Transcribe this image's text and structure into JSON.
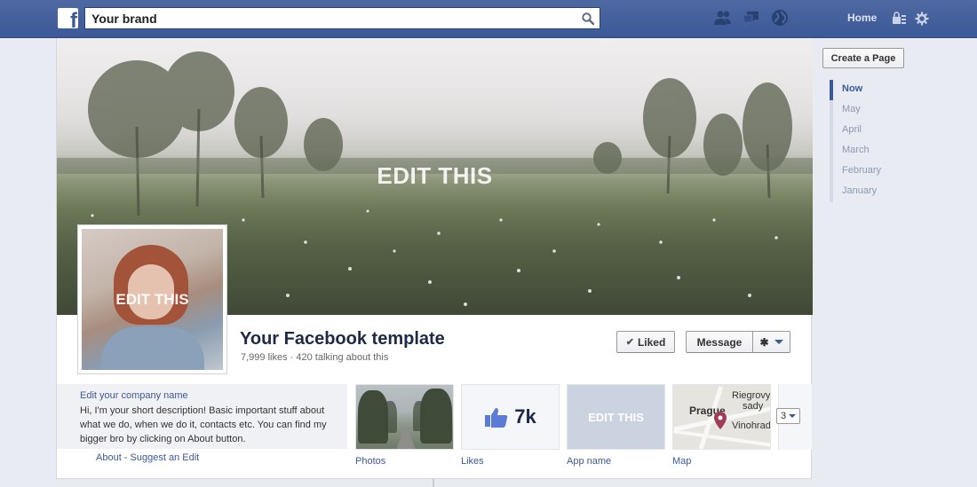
{
  "topbar": {
    "search_value": "Your brand",
    "nav": {
      "home": "Home"
    },
    "icons": [
      "friends-icon",
      "messages-icon",
      "notifications-globe-icon",
      "privacy-icon",
      "settings-gear-icon"
    ]
  },
  "cover": {
    "overlay_text": "EDIT THIS"
  },
  "profile": {
    "overlay_text": "EDIT THIS"
  },
  "page": {
    "name": "Your Facebook template",
    "stats": "7,999 likes · 420 talking about this"
  },
  "actions": {
    "liked": "Liked",
    "message": "Message"
  },
  "about": {
    "company": "Edit your company name",
    "description": "Hi, I'm your short description! Basic important stuff about what we do, when we do it, contacts etc. You can find my bigger bro by clicking on About button.",
    "links": "About - Suggest an Edit"
  },
  "apps": {
    "photos": {
      "label": "Photos"
    },
    "likes": {
      "label": "Likes",
      "count": "7k"
    },
    "custom": {
      "label": "App name",
      "overlay_text": "EDIT THIS"
    },
    "map": {
      "label": "Map",
      "city": "Prague",
      "district_1": "Riegrovy",
      "district_2": "sady",
      "district_3": "Vinohradsk"
    }
  },
  "more": {
    "count": "3"
  },
  "sidebar": {
    "create_page": "Create a Page",
    "timeline": [
      "Now",
      "May",
      "April",
      "March",
      "February",
      "January"
    ],
    "active_index": 0
  },
  "colors": {
    "brand": "#3b5998",
    "topbar": "#4e69a2",
    "background": "#e9ebf2"
  }
}
